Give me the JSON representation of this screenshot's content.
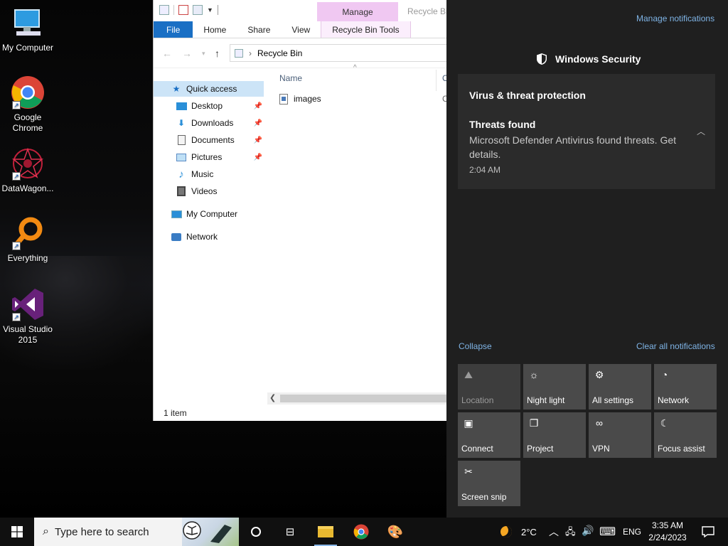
{
  "desktop": {
    "icons": [
      {
        "label": "My Computer"
      },
      {
        "label": "Google Chrome"
      },
      {
        "label": "DataWagon..."
      },
      {
        "label": "Everything"
      },
      {
        "label": "Visual Studio 2015"
      }
    ]
  },
  "explorer": {
    "title_tab": "Manage",
    "window_title": "Recycle Bi",
    "ribbon_tabs": [
      "File",
      "Home",
      "Share",
      "View",
      "Recycle Bin Tools"
    ],
    "address": "Recycle Bin",
    "nav": {
      "quick_access": "Quick access",
      "items": [
        "Desktop",
        "Downloads",
        "Documents",
        "Pictures",
        "Music",
        "Videos"
      ],
      "my_computer": "My Computer",
      "network": "Network"
    },
    "columns": {
      "name": "Name",
      "next": "O"
    },
    "files": [
      {
        "name": "images",
        "col2": "C"
      }
    ],
    "status": "1 item"
  },
  "action_center": {
    "manage_notifications": "Manage notifications",
    "app_name": "Windows Security",
    "notification": {
      "header": "Virus & threat protection",
      "title": "Threats found",
      "body": "Microsoft Defender Antivirus found threats. Get details.",
      "time": "2:04 AM"
    },
    "collapse": "Collapse",
    "clear_all": "Clear all notifications",
    "tiles": [
      {
        "label": "Location",
        "icon": "location-icon",
        "enabled": false
      },
      {
        "label": "Night light",
        "icon": "sun-icon",
        "enabled": true
      },
      {
        "label": "All settings",
        "icon": "gear-icon",
        "enabled": true
      },
      {
        "label": "Network",
        "icon": "network-icon",
        "enabled": true
      },
      {
        "label": "Connect",
        "icon": "connect-icon",
        "enabled": true
      },
      {
        "label": "Project",
        "icon": "project-icon",
        "enabled": true
      },
      {
        "label": "VPN",
        "icon": "vpn-icon",
        "enabled": true
      },
      {
        "label": "Focus assist",
        "icon": "moon-icon",
        "enabled": true
      },
      {
        "label": "Screen snip",
        "icon": "snip-icon",
        "enabled": true
      }
    ]
  },
  "taskbar": {
    "search_placeholder": "Type here to search",
    "weather": "2°C",
    "language": "ENG",
    "time": "3:35 AM",
    "date": "2/24/2023"
  },
  "colors": {
    "accent_blue": "#1a6fc4",
    "manage_tab": "#f0c8f2",
    "action_center_bg": "#1f1f1f",
    "link": "#7fb4e6"
  }
}
